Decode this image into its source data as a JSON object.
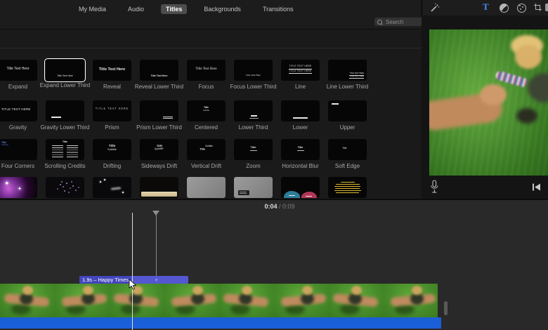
{
  "tabs": {
    "items": [
      {
        "label": "My Media"
      },
      {
        "label": "Audio"
      },
      {
        "label": "Titles"
      },
      {
        "label": "Backgrounds"
      },
      {
        "label": "Transitions"
      }
    ],
    "active_index": 2
  },
  "search": {
    "placeholder": "Search"
  },
  "adjust_toolbar": {
    "text_tool_label": "T"
  },
  "transport": {
    "current": "0:04",
    "separator": " / ",
    "total": "0:09"
  },
  "timeline": {
    "title_clip_label": "1.9s – Happy Times"
  },
  "titles_panel": {
    "sample_text": "Title Text Here",
    "sample_caps": "TITLE TEXT HERE",
    "word_title": "Title",
    "word_subtitle": "Subtitle",
    "selected_item": "Expand Lower Third",
    "rows": [
      {
        "items": [
          {
            "label": "Expand"
          },
          {
            "label": "Expand Lower Third"
          },
          {
            "label": "Reveal"
          },
          {
            "label": "Reveal Lower Third"
          },
          {
            "label": "Focus"
          },
          {
            "label": "Focus Lower Third"
          },
          {
            "label": "Line"
          },
          {
            "label": "Line Lower Third"
          }
        ]
      },
      {
        "items": [
          {
            "label": "Gravity"
          },
          {
            "label": "Gravity Lower Third"
          },
          {
            "label": "Prism"
          },
          {
            "label": "Prism Lower Third"
          },
          {
            "label": "Centered"
          },
          {
            "label": "Lower Third"
          },
          {
            "label": "Lower"
          },
          {
            "label": "Upper"
          }
        ]
      },
      {
        "items": [
          {
            "label": "Four Corners"
          },
          {
            "label": "Scrolling Credits"
          },
          {
            "label": "Drifting"
          },
          {
            "label": "Sideways Drift"
          },
          {
            "label": "Vertical Drift"
          },
          {
            "label": "Zoom"
          },
          {
            "label": "Horizontal Blur"
          },
          {
            "label": "Soft Edge"
          }
        ]
      },
      {
        "items": [
          {
            "visual": "sparkle-stars"
          },
          {
            "visual": "particle-burst"
          },
          {
            "visual": "pixie-dust"
          },
          {
            "visual": "paper-strip"
          },
          {
            "visual": "gray-card"
          },
          {
            "visual": "gray-card-label"
          },
          {
            "visual": "torn-paper-shapes"
          },
          {
            "visual": "yellow-crawl-text"
          }
        ]
      }
    ]
  },
  "colors": {
    "accent_blue": "#4a8cf5",
    "clip_purple": "#5457d0",
    "music_blue": "#1a5ed8"
  }
}
